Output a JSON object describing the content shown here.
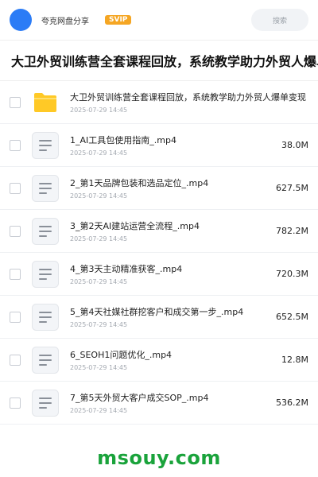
{
  "header": {
    "brand": "夸克网盘分享",
    "badge": "SVIP",
    "search_placeholder": "搜索"
  },
  "page_title": "大卫外贸训练营全套课程回放，系统教学助力外贸人爆单变现",
  "files": [
    {
      "type": "folder",
      "name": "大卫外贸训练营全套课程回放，系统教学助力外贸人爆单变现",
      "date": "2025-07-29 14:45",
      "size": ""
    },
    {
      "type": "file",
      "name": "1_AI工具包使用指南_.mp4",
      "date": "2025-07-29 14:45",
      "size": "38.0M"
    },
    {
      "type": "file",
      "name": "2_第1天品牌包装和选品定位_.mp4",
      "date": "2025-07-29 14:45",
      "size": "627.5M"
    },
    {
      "type": "file",
      "name": "3_第2天AI建站运营全流程_.mp4",
      "date": "2025-07-29 14:45",
      "size": "782.2M"
    },
    {
      "type": "file",
      "name": "4_第3天主动精准获客_.mp4",
      "date": "2025-07-29 14:45",
      "size": "720.3M"
    },
    {
      "type": "file",
      "name": "5_第4天社媒社群挖客户和成交第一步_.mp4",
      "date": "2025-07-29 14:45",
      "size": "652.5M"
    },
    {
      "type": "file",
      "name": "6_SEOH1问题优化_.mp4",
      "date": "2025-07-29 14:45",
      "size": "12.8M"
    },
    {
      "type": "file",
      "name": "7_第5天外贸大客户成交SOP_.mp4",
      "date": "2025-07-29 14:45",
      "size": "536.2M"
    }
  ],
  "watermark": "msouy.com",
  "colors": {
    "avatar": "#2b7cf6",
    "badge": "#f5a623",
    "folder": "#ffc926",
    "watermark": "#1aa33b"
  },
  "icons": {
    "folder": "folder-icon",
    "file": "document-icon"
  }
}
